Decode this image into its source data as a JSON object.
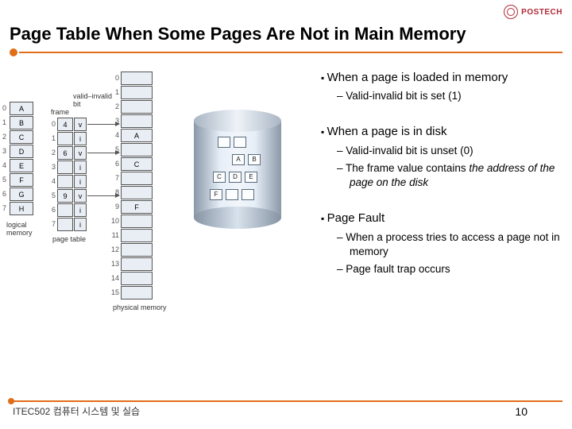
{
  "logo": {
    "text": "POSTECH"
  },
  "title": "Page Table When Some Pages Are Not in Main Memory",
  "bullets": {
    "a": {
      "head": "When a page is loaded in memory",
      "s1": "Valid-invalid bit is set (1)"
    },
    "b": {
      "head": "When a page is in disk",
      "s1": "Valid-invalid bit is unset (0)",
      "s2a": "The frame value contains ",
      "s2b": "the address of the page on the disk"
    },
    "c": {
      "head": "Page Fault",
      "s1": "When a process tries to access a page not in memory",
      "s2": "Page fault trap occurs"
    }
  },
  "diagram": {
    "logical_label": "logical\nmemory",
    "pagetable_label": "page table",
    "physical_label": "physical memory",
    "vi_label": "valid–invalid\nbit",
    "frame_label": "frame",
    "logical": [
      "A",
      "B",
      "C",
      "D",
      "E",
      "F",
      "G",
      "H"
    ],
    "logical_idx": [
      "0",
      "1",
      "2",
      "3",
      "4",
      "5",
      "6",
      "7"
    ],
    "pt_idx": [
      "0",
      "1",
      "2",
      "3",
      "4",
      "5",
      "6",
      "7"
    ],
    "pt_frame": [
      "4",
      "",
      "6",
      "",
      "",
      "9",
      "",
      ""
    ],
    "pt_valid": [
      "v",
      "i",
      "v",
      "i",
      "i",
      "v",
      "i",
      "i"
    ],
    "phys_idx": [
      "0",
      "1",
      "2",
      "3",
      "4",
      "5",
      "6",
      "7",
      "8",
      "9",
      "10",
      "11",
      "12",
      "13",
      "14",
      "15"
    ],
    "phys_val": [
      "",
      "",
      "",
      "",
      "A",
      "",
      "C",
      "",
      "",
      "F",
      "",
      "",
      "",
      "",
      "",
      ""
    ],
    "disk": {
      "r0": [
        "",
        ""
      ],
      "r1": [
        "A",
        "B"
      ],
      "r2": [
        "C",
        "D",
        "E"
      ],
      "r3": [
        "F",
        "",
        ""
      ]
    }
  },
  "footer": {
    "left": "ITEC502 컴퓨터 시스템 및 실습",
    "page": "10"
  }
}
